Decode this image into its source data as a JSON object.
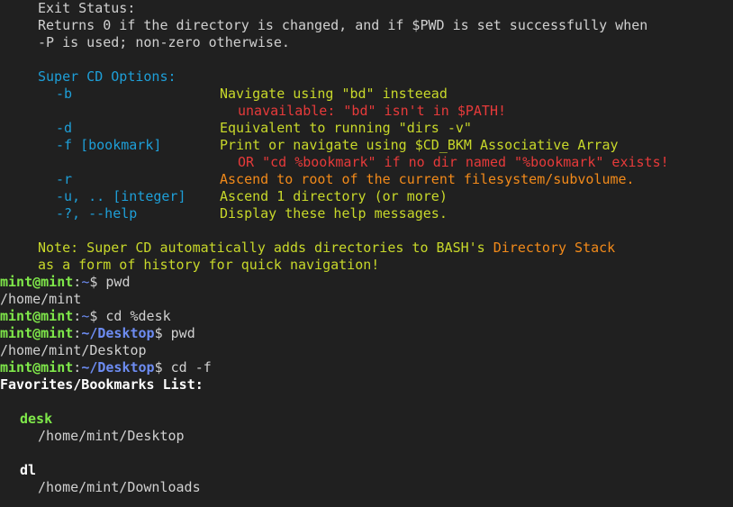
{
  "colors": {
    "background": "#202020",
    "default_text": "#d0d0d0",
    "cyan": "#1e9fd8",
    "yellow_green": "#c8d82a",
    "orange": "#f28a1a",
    "red": "#e63a3a",
    "prompt_green": "#7fe84a",
    "prompt_blue": "#6d8cf2",
    "white": "#ffffff",
    "bookmark_green": "#7fe84a"
  },
  "help": {
    "exit_status_title": "Exit Status:",
    "exit_status_line1": "Returns 0 if the directory is changed, and if $PWD is set successfully when",
    "exit_status_line2": "-P is used; non-zero otherwise.",
    "options_title": "Super CD Options:",
    "options": [
      {
        "flag": "-b",
        "desc": "Navigate using \"bd\" insteead",
        "cont": "unavailable: \"bd\" isn't in $PATH!"
      },
      {
        "flag": "-d",
        "desc": "Equivalent to running \"dirs -v\""
      },
      {
        "flag": "-f [bookmark]",
        "desc": "Print or navigate using $CD_BKM Associative Array",
        "cont": "OR \"cd %bookmark\" if no dir named \"%bookmark\" exists!"
      },
      {
        "flag": "-r",
        "desc": "Ascend to root of the current filesystem/subvolume."
      },
      {
        "flag": "-u, .. [integer]",
        "desc": "Ascend 1 directory (or more)"
      },
      {
        "flag": "-?, --help",
        "desc": "Display these help messages."
      }
    ],
    "note_prefix": "Note: Super CD automatically adds directories to BASH's ",
    "note_highlight": "Directory Stack",
    "note_line2": "as a form of history for quick navigation!"
  },
  "session": {
    "prompt_user": "mint@mint",
    "prompt_colon": ":",
    "cmd1_path": "~",
    "cmd1_sigil": "$ ",
    "cmd1": "pwd",
    "out1": "/home/mint",
    "cmd2_path": "~",
    "cmd2_sigil": "$ ",
    "cmd2": "cd %desk",
    "cmd3_path": "~/Desktop",
    "cmd3_sigil": "$ ",
    "cmd3": "pwd",
    "out3": "/home/mint/Desktop",
    "cmd4_path": "~/Desktop",
    "cmd4_sigil": "$ ",
    "cmd4": "cd -f",
    "list_title": "Favorites/Bookmarks List:",
    "bookmarks": [
      {
        "name": "desk",
        "path": "/home/mint/Desktop"
      },
      {
        "name": "dl",
        "path": "/home/mint/Downloads"
      }
    ]
  }
}
